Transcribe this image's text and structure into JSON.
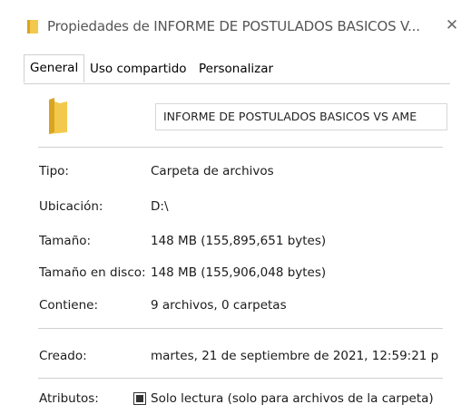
{
  "window": {
    "title": "Propiedades de INFORME DE POSTULADOS BASICOS V...",
    "close_glyph": "✕",
    "title_icon": "folder-icon"
  },
  "tabs": [
    {
      "label": "General",
      "active": true
    },
    {
      "label": "Uso compartido",
      "active": false
    },
    {
      "label": "Personalizar",
      "active": false
    }
  ],
  "general": {
    "folder_icon": "folder-icon",
    "name_value": "INFORME DE POSTULADOS BASICOS VS AME",
    "rows": {
      "tipo": {
        "label": "Tipo:",
        "value": "Carpeta de archivos"
      },
      "ubicacion": {
        "label": "Ubicación:",
        "value": "D:\\"
      },
      "tamano": {
        "label": "Tamaño:",
        "value": "148 MB (155,895,651 bytes)"
      },
      "tamano_disco": {
        "label": "Tamaño en disco:",
        "value": "148 MB (155,906,048 bytes)"
      },
      "contiene": {
        "label": "Contiene:",
        "value": "9 archivos, 0 carpetas"
      },
      "creado": {
        "label": "Creado:",
        "value": "martes, 21 de septiembre de 2021, 12:59:21 p"
      },
      "atributos": {
        "label": "Atributos:",
        "readonly_label": "Solo lectura (solo para archivos de la carpeta)",
        "readonly_state": "indeterminate"
      }
    }
  },
  "colors": {
    "folder_yellow": "#f2c94c",
    "folder_dark": "#d9a520"
  }
}
